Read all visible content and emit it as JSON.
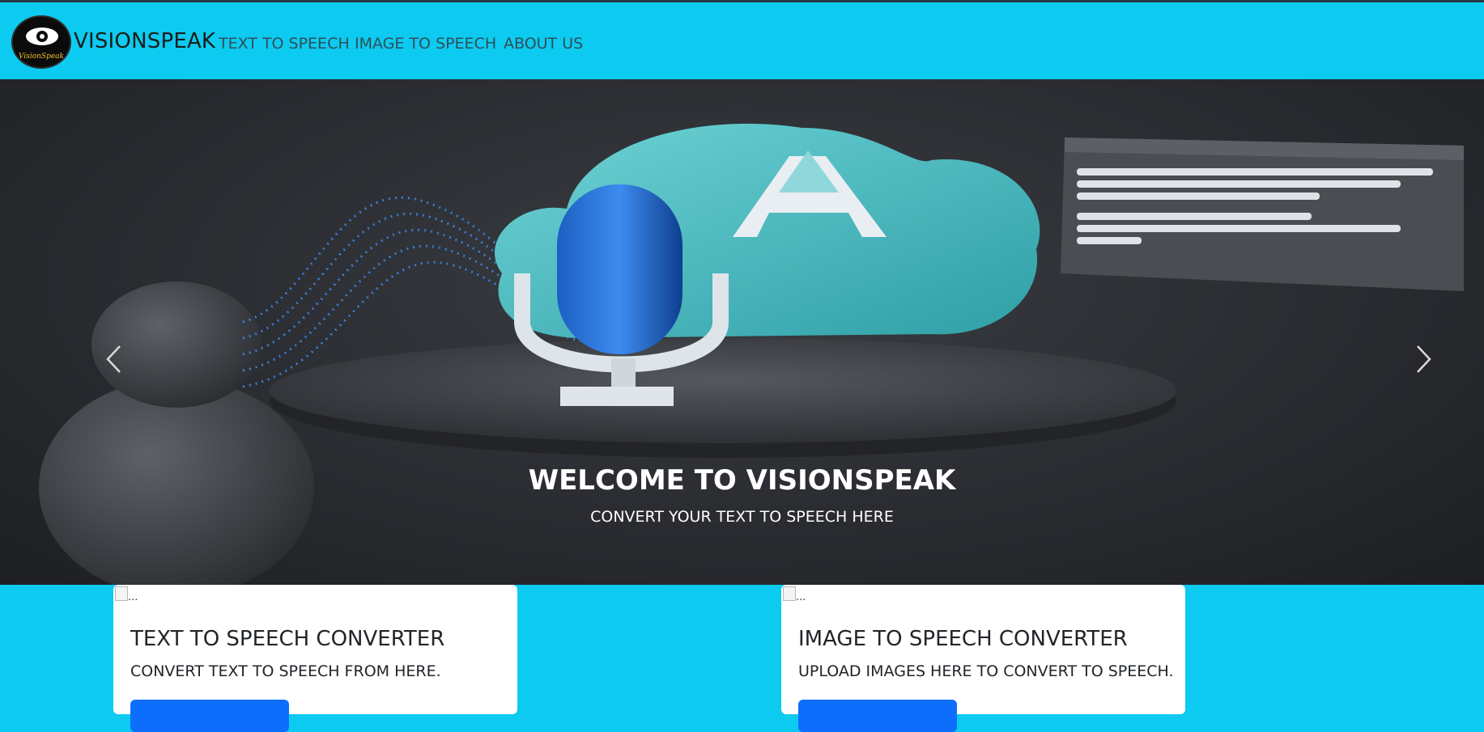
{
  "navbar": {
    "brand": "VISIONSPEAK",
    "logo_text": "VisionSpeak",
    "links": [
      {
        "label": "TEXT TO SPEECH"
      },
      {
        "label": "IMAGE TO SPEECH"
      },
      {
        "label": "ABOUT US"
      }
    ],
    "background_color": "#0dcaf0"
  },
  "carousel": {
    "title": "WELCOME TO VISIONSPEAK",
    "subtitle": "CONVERT YOUR TEXT TO SPEECH HERE",
    "prev_icon": "chevron-left-icon",
    "next_icon": "chevron-right-icon"
  },
  "cards": [
    {
      "image_alt": "...",
      "title": "TEXT TO SPEECH CONVERTER",
      "text": "CONVERT TEXT TO SPEECH FROM HERE."
    },
    {
      "image_alt": "...",
      "title": "IMAGE TO SPEECH CONVERTER",
      "text": "UPLOAD IMAGES HERE TO CONVERT TO SPEECH."
    }
  ],
  "colors": {
    "accent": "#0dcaf0",
    "button": "#0d6efd"
  }
}
